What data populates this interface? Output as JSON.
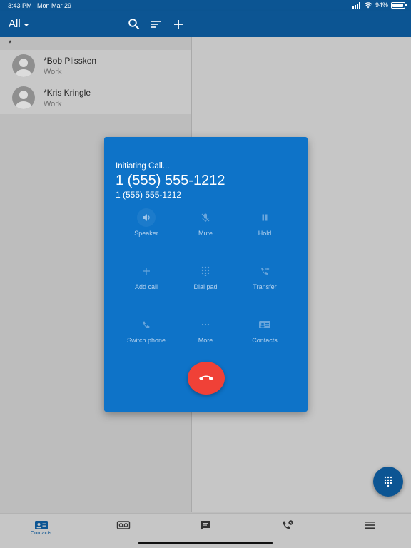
{
  "status_bar": {
    "time": "3:43 PM",
    "date": "Mon Mar 29",
    "battery": "94%",
    "battery_level": 0.94
  },
  "app_bar": {
    "filter_label": "All",
    "icons": [
      "search-icon",
      "sort-icon",
      "add-icon"
    ]
  },
  "contacts": {
    "section_header": "*",
    "items": [
      {
        "name": "*Bob Plissken",
        "type": "Work"
      },
      {
        "name": "*Kris Kringle",
        "type": "Work"
      }
    ]
  },
  "call": {
    "status": "Initiating Call...",
    "number_primary": "1 (555) 555-1212",
    "number_secondary": "1 (555) 555-1212",
    "buttons": [
      {
        "label": "Speaker",
        "icon": "speaker-icon"
      },
      {
        "label": "Mute",
        "icon": "mute-icon"
      },
      {
        "label": "Hold",
        "icon": "pause-icon"
      },
      {
        "label": "Add call",
        "icon": "plus-icon"
      },
      {
        "label": "Dial pad",
        "icon": "dialpad-icon"
      },
      {
        "label": "Transfer",
        "icon": "transfer-icon"
      },
      {
        "label": "Switch phone",
        "icon": "phone-icon"
      },
      {
        "label": "More",
        "icon": "more-icon"
      },
      {
        "label": "Contacts",
        "icon": "contact-card-icon"
      }
    ],
    "hangup_icon": "hangup-icon"
  },
  "fab_icon": "dialpad-icon",
  "bottom_nav": {
    "items": [
      {
        "label": "Contacts",
        "icon": "contacts-icon",
        "active": true
      },
      {
        "label": "",
        "icon": "voicemail-icon"
      },
      {
        "label": "",
        "icon": "chat-icon"
      },
      {
        "label": "",
        "icon": "call-history-icon"
      },
      {
        "label": "",
        "icon": "menu-icon"
      }
    ]
  },
  "colors": {
    "primary": "#0c5593",
    "dialog": "#0e73c8",
    "hangup": "#f04137"
  }
}
